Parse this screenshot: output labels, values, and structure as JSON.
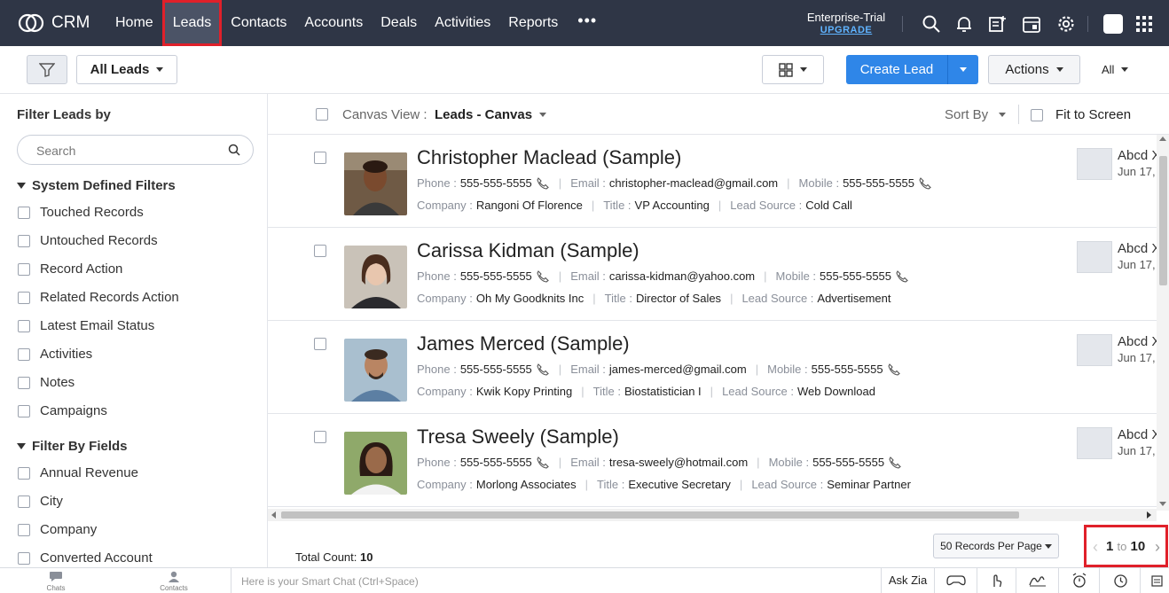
{
  "app": {
    "logo_text": "CRM"
  },
  "nav": {
    "items": [
      "Home",
      "Leads",
      "Contacts",
      "Accounts",
      "Deals",
      "Activities",
      "Reports"
    ],
    "more": "•••",
    "active": "Leads"
  },
  "trial": {
    "label": "Enterprise-Trial",
    "upgrade": "UPGRADE"
  },
  "toolbar": {
    "view_select": "All Leads",
    "create_button": "Create Lead",
    "actions_button": "Actions",
    "all_select": "All"
  },
  "sidebar": {
    "title": "Filter Leads by",
    "search_placeholder": "Search",
    "system_section": "System Defined Filters",
    "system_filters": [
      "Touched Records",
      "Untouched Records",
      "Record Action",
      "Related Records Action",
      "Latest Email Status",
      "Activities",
      "Notes",
      "Campaigns"
    ],
    "field_section": "Filter By Fields",
    "field_filters": [
      "Annual Revenue",
      "City",
      "Company",
      "Converted Account"
    ]
  },
  "canvas": {
    "view_label": "Canvas View :",
    "view_value": "Leads - Canvas",
    "sort_by": "Sort By",
    "fit_to_screen": "Fit to Screen"
  },
  "labels": {
    "phone": "Phone :",
    "email": "Email :",
    "mobile": "Mobile :",
    "company": "Company :",
    "title": "Title :",
    "lead_source": "Lead Source :"
  },
  "leads": [
    {
      "name": "Christopher Maclead (Sample)",
      "phone": "555-555-5555",
      "email": "christopher-maclead@gmail.com",
      "mobile": "555-555-5555",
      "company": "Rangoni Of Florence",
      "title": "VP Accounting",
      "lead_source": "Cold Call",
      "owner": "Abcd X",
      "date": "Jun 17,"
    },
    {
      "name": "Carissa Kidman (Sample)",
      "phone": "555-555-5555",
      "email": "carissa-kidman@yahoo.com",
      "mobile": "555-555-5555",
      "company": "Oh My Goodknits Inc",
      "title": "Director of Sales",
      "lead_source": "Advertisement",
      "owner": "Abcd X",
      "date": "Jun 17,"
    },
    {
      "name": "James Merced (Sample)",
      "phone": "555-555-5555",
      "email": "james-merced@gmail.com",
      "mobile": "555-555-5555",
      "company": "Kwik Kopy Printing",
      "title": "Biostatistician I",
      "lead_source": "Web Download",
      "owner": "Abcd X",
      "date": "Jun 17,"
    },
    {
      "name": "Tresa Sweely (Sample)",
      "phone": "555-555-5555",
      "email": "tresa-sweely@hotmail.com",
      "mobile": "555-555-5555",
      "company": "Morlong Associates",
      "title": "Executive Secretary",
      "lead_source": "Seminar Partner",
      "owner": "Abcd X",
      "date": "Jun 17,"
    }
  ],
  "footer": {
    "total_label": "Total Count:",
    "total_value": "10",
    "per_page": "50 Records Per Page",
    "page_from": "1",
    "page_to_word": "to",
    "page_to": "10"
  },
  "bottombar": {
    "chats": "Chats",
    "contacts": "Contacts",
    "smart_chat_placeholder": "Here is your Smart Chat (Ctrl+Space)",
    "ask_zia": "Ask Zia"
  },
  "colors": {
    "nav_bg": "#2f3646",
    "primary": "#2f86e8",
    "highlight": "#e0202a"
  }
}
